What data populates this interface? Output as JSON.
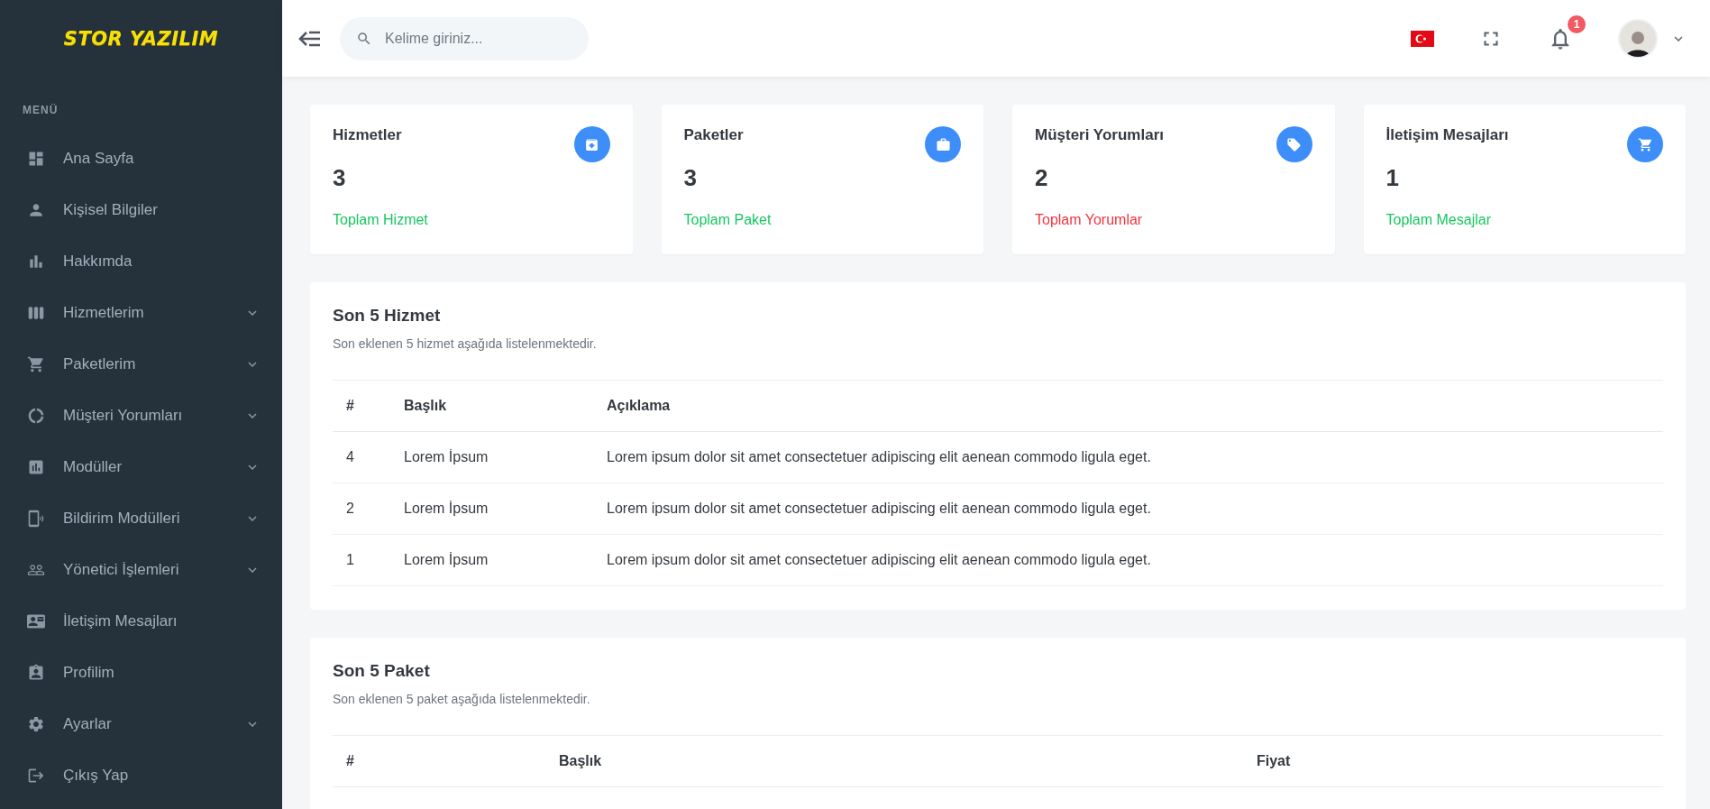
{
  "brand": {
    "logo_text": "STOR YAZILIM"
  },
  "sidebar": {
    "heading": "MENÜ",
    "items": [
      {
        "label": "Ana Sayfa",
        "has_submenu": false
      },
      {
        "label": "Kişisel Bilgiler",
        "has_submenu": false
      },
      {
        "label": "Hakkımda",
        "has_submenu": false
      },
      {
        "label": "Hizmetlerim",
        "has_submenu": true
      },
      {
        "label": "Paketlerim",
        "has_submenu": true
      },
      {
        "label": "Müşteri Yorumları",
        "has_submenu": true
      },
      {
        "label": "Modüller",
        "has_submenu": true
      },
      {
        "label": "Bildirim Modülleri",
        "has_submenu": true
      },
      {
        "label": "Yönetici İşlemleri",
        "has_submenu": true
      },
      {
        "label": "İletişim Mesajları",
        "has_submenu": false
      },
      {
        "label": "Profilim",
        "has_submenu": false
      },
      {
        "label": "Ayarlar",
        "has_submenu": true
      },
      {
        "label": "Çıkış Yap",
        "has_submenu": false
      }
    ]
  },
  "header": {
    "search": {
      "placeholder": "Kelime giriniz..."
    },
    "notification_count": "1"
  },
  "stat_cards": [
    {
      "title": "Hizmetler",
      "value": "3",
      "caption": "Toplam Hizmet",
      "color": "#16c75e"
    },
    {
      "title": "Paketler",
      "value": "3",
      "caption": "Toplam Paket",
      "color": "#16c75e"
    },
    {
      "title": "Müşteri Yorumları",
      "value": "2",
      "caption": "Toplam Yorumlar",
      "color": "#f5333f"
    },
    {
      "title": "İletişim Mesajları",
      "value": "1",
      "caption": "Toplam Mesajlar",
      "color": "#16c75e"
    }
  ],
  "services_panel": {
    "title": "Son 5 Hizmet",
    "subtitle": "Son eklenen 5 hizmet aşağıda listelenmektedir.",
    "columns": [
      "#",
      "Başlık",
      "Açıklama"
    ],
    "rows": [
      [
        "4",
        "Lorem İpsum",
        "Lorem ipsum dolor sit amet consectetuer adipiscing elit aenean commodo ligula eget."
      ],
      [
        "2",
        "Lorem İpsum",
        "Lorem ipsum dolor sit amet consectetuer adipiscing elit aenean commodo ligula eget."
      ],
      [
        "1",
        "Lorem İpsum",
        "Lorem ipsum dolor sit amet consectetuer adipiscing elit aenean commodo ligula eget."
      ]
    ]
  },
  "packages_panel": {
    "title": "Son 5 Paket",
    "subtitle": "Son eklenen 5 paket aşağıda listelenmektedir.",
    "columns": [
      "#",
      "Başlık",
      "Fiyat"
    ]
  }
}
